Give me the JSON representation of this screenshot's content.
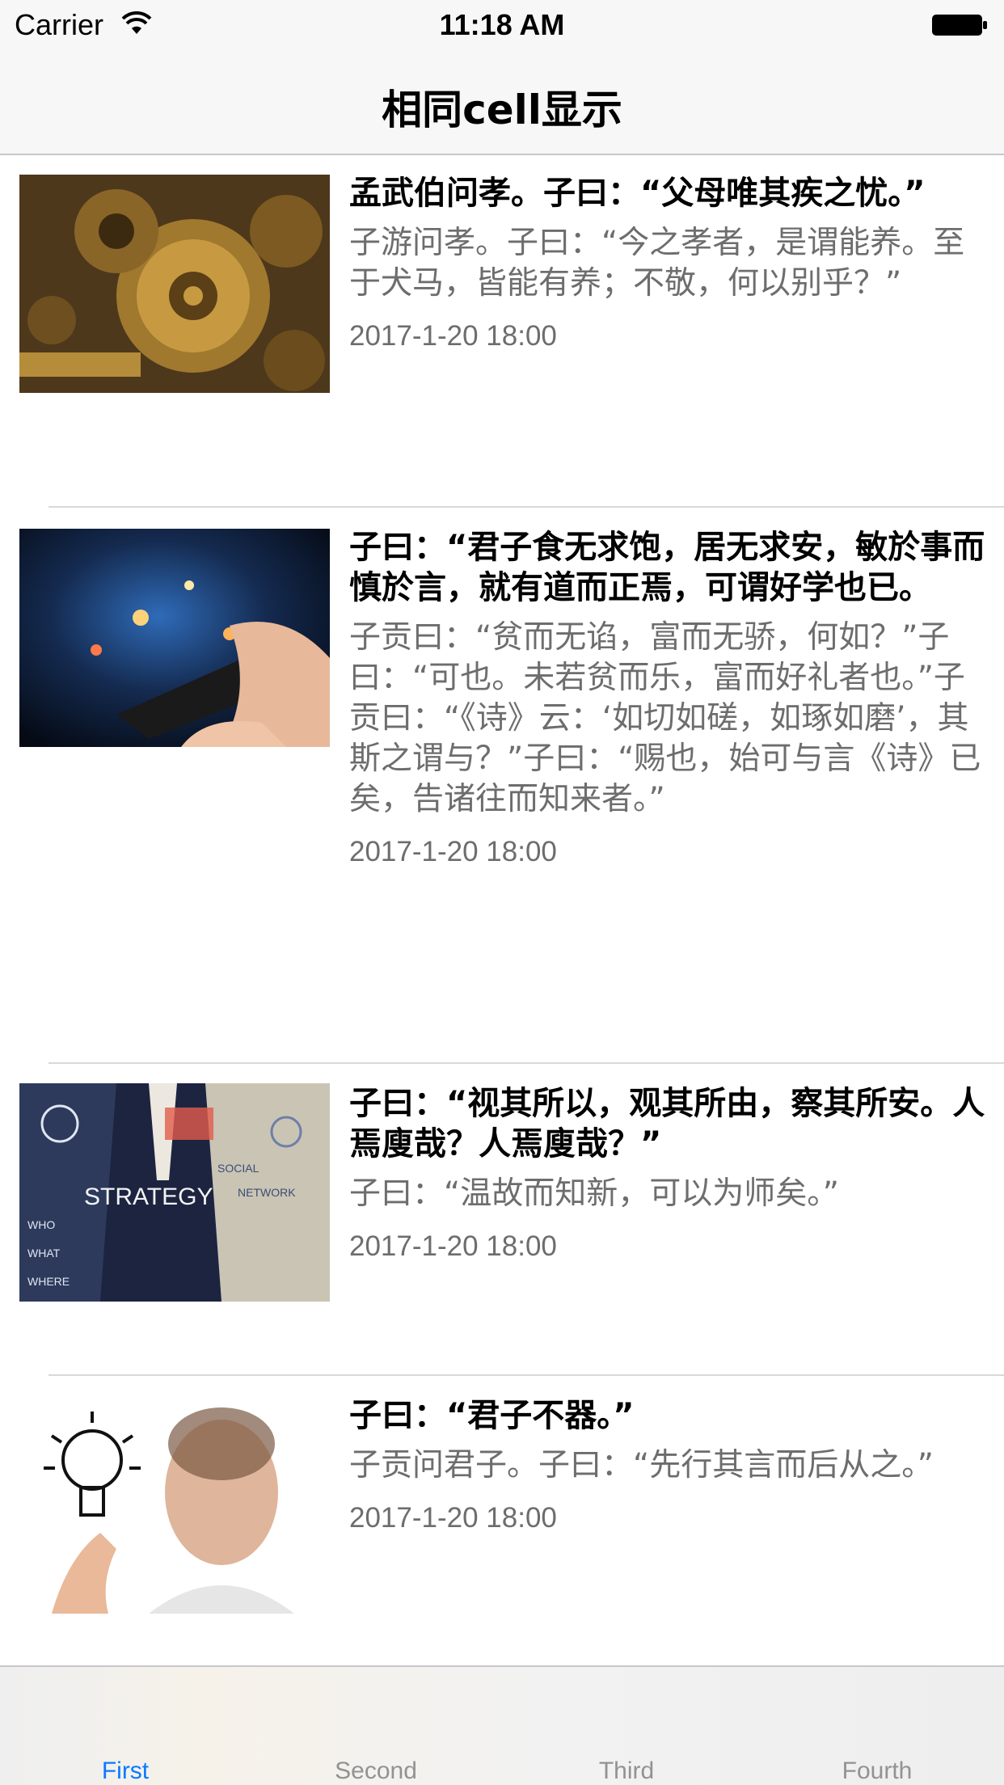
{
  "status_bar": {
    "carrier": "Carrier",
    "time": "11:18 AM"
  },
  "nav": {
    "title": "相同cell显示"
  },
  "cells": [
    {
      "image": "gears-photo",
      "title": " 孟武伯问孝。子曰：“父母唯其疾之忧。”",
      "body": "子游问孝。子曰：“今之孝者，是谓能养。至于犬马，皆能有养；不敬，何以别乎？”",
      "date": "2017-1-20 18:00"
    },
    {
      "image": "smartphone-hands-photo",
      "title": "子曰：“君子食无求饱，居无求安，敏於事而慎於言，就有道而正焉，可谓好学也已。",
      "body": "子贡曰：“贫而无谄，富而无骄，何如？”子曰：“可也。未若贫而乐，富而好礼者也。”子贡曰：“《诗》云：‘如切如磋，如琢如磨’，其斯之谓与？”子曰：“赐也，始可与言《诗》已矣，告诸往而知来者。”",
      "date": "2017-1-20 18:00"
    },
    {
      "image": "strategy-businessman-photo",
      "title": "子曰：“视其所以，观其所由，察其所安。人焉廋哉？人焉廋哉？”",
      "body": "子曰：“温故而知新，可以为师矣。”",
      "date": "2017-1-20 18:00"
    },
    {
      "image": "lightbulb-man-photo",
      "title": "子曰：“君子不器。”",
      "body": "子贡问君子。子曰：“先行其言而后从之。”",
      "date": "2017-1-20 18:00"
    }
  ],
  "tabs": [
    {
      "label": "First",
      "active": true
    },
    {
      "label": "Second",
      "active": false
    },
    {
      "label": "Third",
      "active": false
    },
    {
      "label": "Fourth",
      "active": false
    }
  ],
  "colors": {
    "tab_active": "#0a7aff",
    "tab_inactive": "#929292",
    "secondary_text": "#6d6d6d",
    "separator": "#d9d9dc"
  }
}
